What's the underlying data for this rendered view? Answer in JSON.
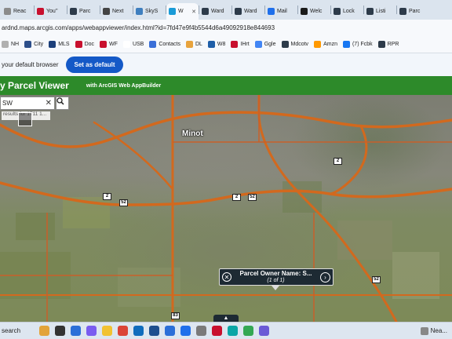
{
  "browser": {
    "tabs": [
      {
        "label": "Reac",
        "color": "#8b8b8b"
      },
      {
        "label": "You'’",
        "color": "#c8102e"
      },
      {
        "label": "Parc",
        "color": "#2d3b4a"
      },
      {
        "label": "Next",
        "color": "#444444"
      },
      {
        "label": "SkyS",
        "color": "#3f7fbf"
      },
      {
        "label": "W",
        "color": "#1a9bd7",
        "active": true
      },
      {
        "label": "Ward",
        "color": "#2d3b4a"
      },
      {
        "label": "Ward",
        "color": "#2d3b4a"
      },
      {
        "label": "Mail",
        "color": "#1f6feb"
      },
      {
        "label": "Welc",
        "color": "#1a1a1a"
      },
      {
        "label": "Lock",
        "color": "#2d3b4a"
      },
      {
        "label": "Listi",
        "color": "#2d3b4a"
      },
      {
        "label": "Parc",
        "color": "#2d3b4a"
      }
    ],
    "url": "ardnd.maps.arcgis.com/apps/webappviewer/index.html?id=7fd47e9f4b5544d6a49092918e844693",
    "bookmarks": [
      {
        "label": "NH",
        "color": "#b0b0b0"
      },
      {
        "label": "City",
        "color": "#2d4f8a"
      },
      {
        "label": "MLS",
        "color": "#1c3f7a"
      },
      {
        "label": "Doc",
        "color": "#c8102e"
      },
      {
        "label": "WF",
        "color": "#c8102e"
      },
      {
        "label": "USB",
        "color": "#ffffff"
      },
      {
        "label": "Contacts",
        "color": "#3a6fd8"
      },
      {
        "label": "DL",
        "color": "#e8a33d"
      },
      {
        "label": "W8",
        "color": "#1f5fa8"
      },
      {
        "label": "IHrt",
        "color": "#c8102e"
      },
      {
        "label": "Ggle",
        "color": "#4285f4"
      },
      {
        "label": "Mdcotv",
        "color": "#2d3b4a"
      },
      {
        "label": "Amzn",
        "color": "#ff9900"
      },
      {
        "label": "(7) Fcbk",
        "color": "#1877f2"
      },
      {
        "label": "RPR",
        "color": "#2d3b4a"
      }
    ],
    "infobar": {
      "text": "your default browser",
      "button": "Set as default"
    }
  },
  "app": {
    "title": "y Parcel Viewer",
    "subtitle": "with ArcGIS Web AppBuilder"
  },
  "map": {
    "search_value": "SW",
    "search_hint": "results for 1711 1...",
    "city_label": "Minot",
    "route_shields": [
      {
        "label": "2"
      },
      {
        "label": "2"
      },
      {
        "label": "52"
      },
      {
        "label": "2"
      },
      {
        "label": "52"
      },
      {
        "label": "52"
      },
      {
        "label": "83"
      }
    ],
    "popup": {
      "title": "Parcel Owner Name: S...",
      "count": "(1 of 1)"
    },
    "colors": {
      "highway": "#d2691e",
      "road": "#c8602a"
    }
  },
  "taskbar": {
    "search_text": "search",
    "apps": [
      {
        "name": "copilot-icon",
        "color": "#e2a33a"
      },
      {
        "name": "task-view-icon",
        "color": "#333333"
      },
      {
        "name": "widgets-icon",
        "color": "#2b6fd8"
      },
      {
        "name": "copilot-app-icon",
        "color": "#7a5cf0"
      },
      {
        "name": "file-explorer-icon",
        "color": "#f1c232"
      },
      {
        "name": "chrome-icon",
        "color": "#db4437"
      },
      {
        "name": "outlook-icon",
        "color": "#0f6cbd"
      },
      {
        "name": "powershell-icon",
        "color": "#1e4f8f"
      },
      {
        "name": "app-icon",
        "color": "#2b6fd8"
      },
      {
        "name": "store-icon",
        "color": "#1f6feb"
      },
      {
        "name": "app-icon-2",
        "color": "#7a7a7a"
      },
      {
        "name": "app-icon-3",
        "color": "#c8102e"
      },
      {
        "name": "edge-icon",
        "color": "#0aa6a6"
      },
      {
        "name": "chrome-icon-2",
        "color": "#34a853"
      },
      {
        "name": "photos-icon",
        "color": "#6b5bd6"
      }
    ],
    "news_label": "Nea..."
  }
}
